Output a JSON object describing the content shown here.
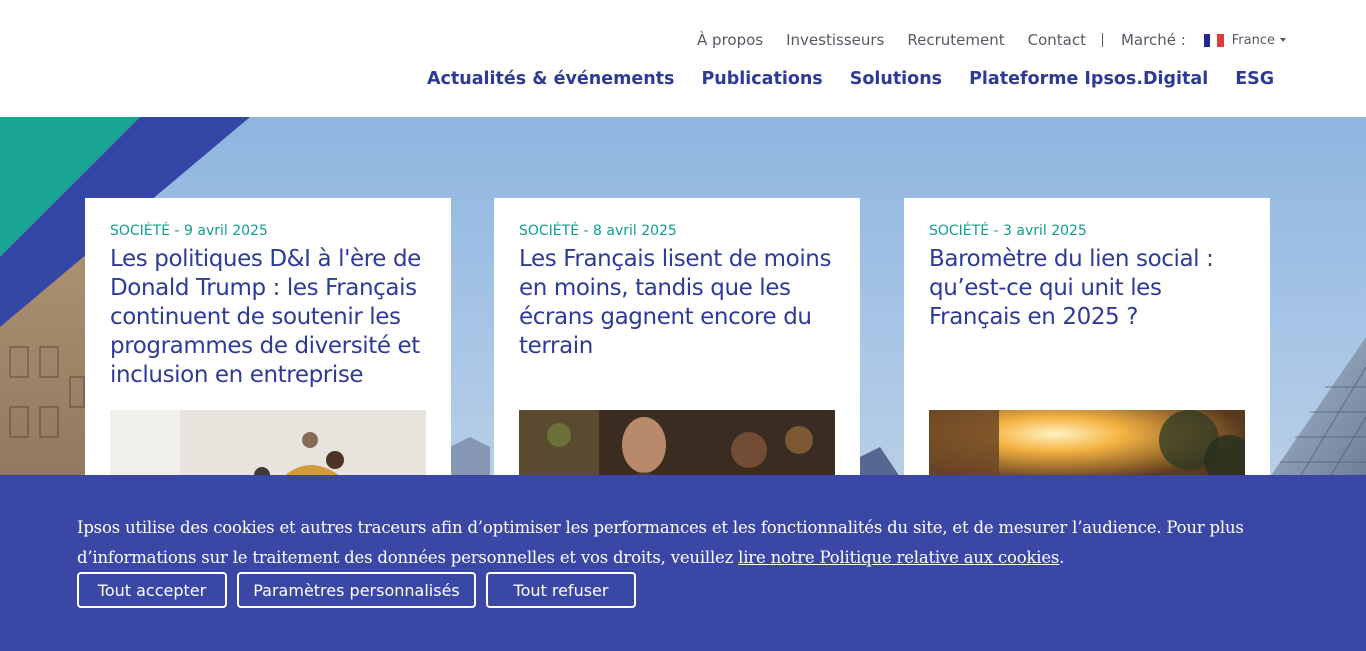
{
  "utility_nav": {
    "about": "À propos",
    "investors": "Investisseurs",
    "recruitment": "Recrutement",
    "contact": "Contact",
    "market_label": "Marché :",
    "market_value": "France",
    "flag_icon": "france-flag-icon"
  },
  "main_nav": [
    {
      "label": "Actualités & événements"
    },
    {
      "label": "Publications"
    },
    {
      "label": "Solutions"
    },
    {
      "label": "Plateforme Ipsos.Digital"
    },
    {
      "label": "ESG"
    }
  ],
  "cards": [
    {
      "meta": "SOCIÉTÉ - 9 avril 2025",
      "title": "Les politiques D&I à l'ère de Donald Trump : les Français continuent de soutenir les programmes de diversité et inclusion en entreprise"
    },
    {
      "meta": "SOCIÉTÉ - 8 avril 2025",
      "title": "Les Français lisent de moins en moins, tandis que les écrans gagnent encore du terrain"
    },
    {
      "meta": "SOCIÉTÉ - 3 avril 2025",
      "title": "Baromètre du lien social : qu’est-ce qui unit les Français en 2025 ?"
    }
  ],
  "cookie_banner": {
    "text_before_link": "Ipsos utilise des cookies et autres traceurs afin d’optimiser les performances et les fonctionnalités du site, et de mesurer l’audience. Pour plus d’informations sur le traitement des données personnelles et vos droits, veuillez ",
    "link_text": "lire notre Politique relative aux cookies",
    "text_after_link": ".",
    "accept_label": "Tout accepter",
    "custom_label": "Paramètres personnalisés",
    "refuse_label": "Tout refuser"
  },
  "colors": {
    "brand_blue": "#2d3b97",
    "teal": "#0f9d8c",
    "banner_blue": "#3a47a5"
  }
}
